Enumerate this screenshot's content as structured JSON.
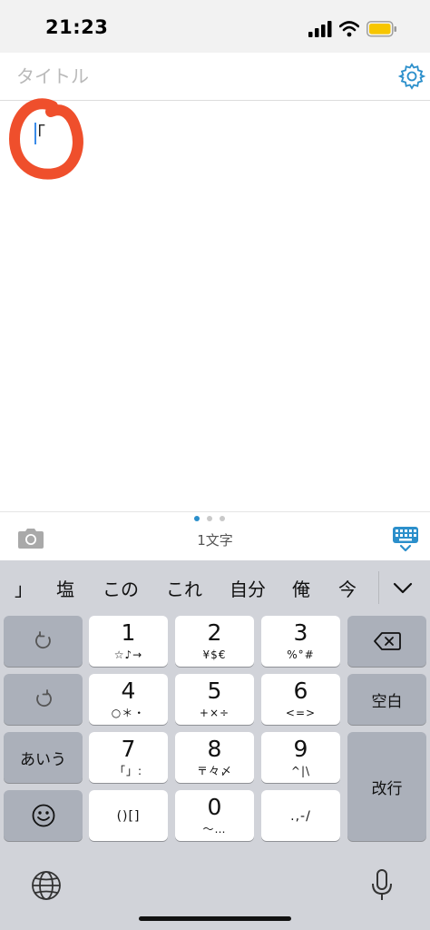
{
  "status_bar": {
    "time": "21:23",
    "battery_color": "#f7c600"
  },
  "note": {
    "title_placeholder": "タイトル",
    "title_value": "",
    "body_text": "「"
  },
  "toolbar": {
    "char_count": "1文字",
    "page_dots": {
      "count": 3,
      "active": 0
    },
    "accent_color": "#2b8fcb"
  },
  "keyboard": {
    "suggestions": [
      "」",
      "塩",
      "この",
      "これ",
      "自分",
      "俺",
      "今"
    ],
    "keys": {
      "k1": {
        "main": "1",
        "sub": "☆♪→"
      },
      "k2": {
        "main": "2",
        "sub": "¥$€"
      },
      "k3": {
        "main": "3",
        "sub": "%°#"
      },
      "k4": {
        "main": "4",
        "sub": "○＊・"
      },
      "k5": {
        "main": "5",
        "sub": "+×÷"
      },
      "k6": {
        "main": "6",
        "sub": "<=>"
      },
      "k7": {
        "main": "7",
        "sub": "「」:"
      },
      "k8": {
        "main": "8",
        "sub": "〒々〆"
      },
      "k9": {
        "main": "9",
        "sub": "^|\\"
      },
      "k0": {
        "main": "0",
        "sub": "〜…"
      },
      "brackets": "()[]",
      "punct": ".,-/"
    },
    "space_label": "空白",
    "mode_label": "あいう",
    "enter_label": "改行"
  }
}
